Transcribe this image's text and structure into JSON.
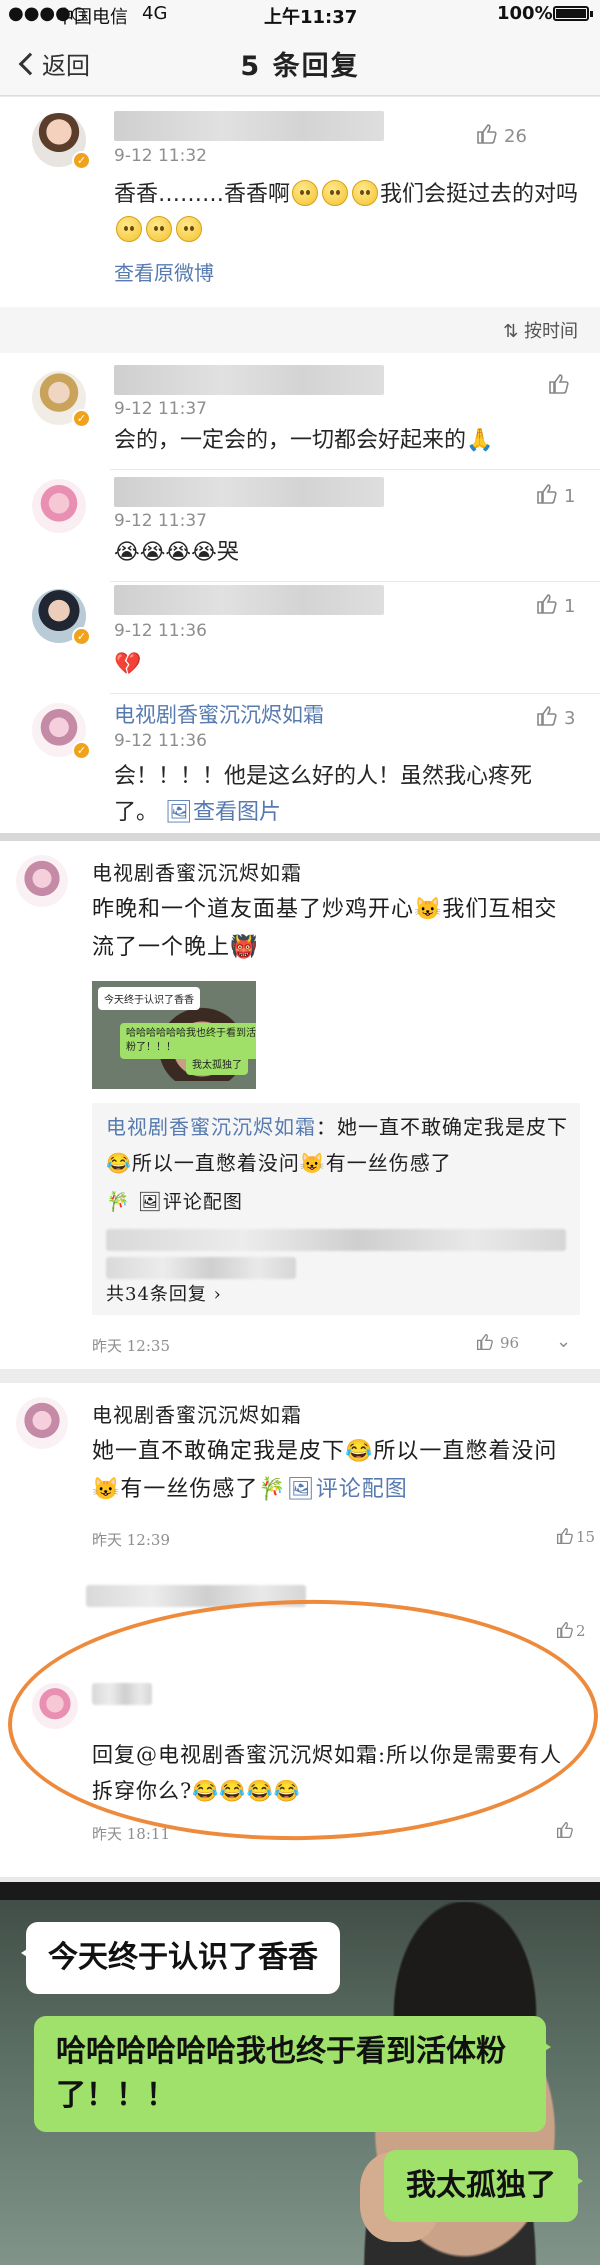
{
  "status_bar": {
    "carrier": "中国电信",
    "network": "4G",
    "time": "上午11:37",
    "battery": "100%"
  },
  "nav": {
    "back_label": "返回",
    "title": "5 条回复"
  },
  "root_comment": {
    "timestamp": "9-12 11:32",
    "likes": "26",
    "text": "香香………香香啊",
    "text_tail": "我们会挺过去的对吗",
    "view_original": "查看原微博"
  },
  "sort_label": "按时间",
  "replies": [
    {
      "timestamp": "9-12 11:37",
      "text": "会的，一定会的，一切都会好起来的🙏",
      "likes": ""
    },
    {
      "timestamp": "9-12 11:37",
      "text": "😭😭😭😭哭",
      "likes": "1"
    },
    {
      "timestamp": "9-12 11:36",
      "text": "💔",
      "likes": "1"
    },
    {
      "timestamp": "9-12 11:36",
      "username": "电视剧香蜜沉沉烬如霜",
      "text": "会！！！！他是这么好的人！虽然我心疼死了。",
      "view_image": "查看图片",
      "likes": "3"
    }
  ],
  "post2": {
    "username": "电视剧香蜜沉沉烬如霜",
    "text": "昨晚和一个道友面基了炒鸡开心😺我们互相交流了一个晚上👹",
    "thumb": {
      "bubble1": "今天终于认识了香香",
      "bubble2": "哈哈哈哈哈哈我也终于看到活体粉了！！！",
      "bubble3": "我太孤独了"
    },
    "quote_name": "电视剧香蜜沉沉烬如霜",
    "quote_text": "她一直不敢确定我是皮下😂所以一直憋着没问😺有一丝伤感了",
    "quote_link": "评论配图",
    "reply_count": "共34条回复",
    "time": "昨天 12:35",
    "likes": "96"
  },
  "post3": {
    "username": "电视剧香蜜沉沉烬如霜",
    "text": "她一直不敢确定我是皮下😂所以一直憋着没问😺有一丝伤感了🎋",
    "link": "评论配图",
    "time": "昨天 12:39",
    "likes": "15",
    "reply_time": "昨天 18:11",
    "reply_likes": "2",
    "reply_text": "回复@电视剧香蜜沉沉烬如霜:所以你是需要有人拆穿你么?😂😂😂😂"
  },
  "meme": {
    "bubble1": "今天终于认识了香香",
    "bubble2": "哈哈哈哈哈哈我也终于看到活体粉了！！！",
    "bubble3": "我太孤独了"
  }
}
